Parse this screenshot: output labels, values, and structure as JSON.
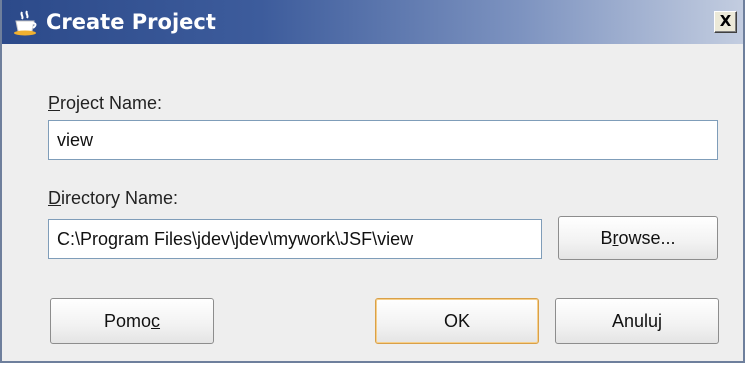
{
  "window": {
    "title": "Create Project",
    "close_label": "X",
    "title_icon": "java-cup-icon"
  },
  "project_name": {
    "label_mnemonic": "P",
    "label_rest": "roject Name:",
    "value": "view"
  },
  "directory_name": {
    "label_mnemonic": "D",
    "label_rest": "irectory Name:",
    "value": "C:\\Program Files\\jdev\\jdev\\mywork\\JSF\\view"
  },
  "buttons": {
    "browse_pre": "B",
    "browse_mnemonic": "r",
    "browse_post": "owse...",
    "help_pre": "Pomo",
    "help_mnemonic": "c",
    "ok": "OK",
    "cancel": "Anuluj"
  },
  "colors": {
    "title_gradient_start": "#2c4a8a",
    "title_gradient_end": "#c3cde0",
    "default_button_border": "#d9a048"
  }
}
